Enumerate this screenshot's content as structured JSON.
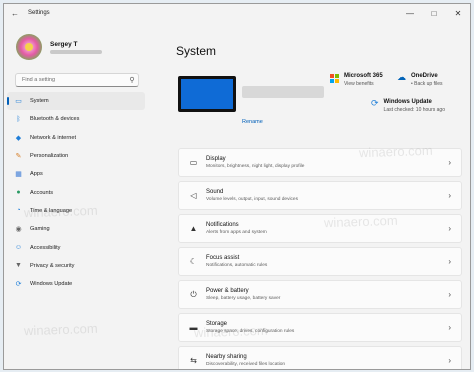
{
  "window": {
    "title": "Settings",
    "controls": [
      "minimize-icon",
      "maximize-icon",
      "close-icon"
    ]
  },
  "profile": {
    "name": "Sergey T"
  },
  "search": {
    "placeholder": "Find a setting"
  },
  "nav": {
    "items": [
      {
        "label": "System",
        "icon": "monitor-icon",
        "active": true,
        "color": "#1f7ed8"
      },
      {
        "label": "Bluetooth & devices",
        "icon": "bluetooth-icon",
        "color": "#1f7ed8"
      },
      {
        "label": "Network & internet",
        "icon": "wifi-icon",
        "color": "#1f7ed8"
      },
      {
        "label": "Personalization",
        "icon": "brush-icon",
        "color": "#d67f2a"
      },
      {
        "label": "Apps",
        "icon": "apps-icon",
        "color": "#3c7bd6"
      },
      {
        "label": "Accounts",
        "icon": "person-icon",
        "color": "#2a9a64"
      },
      {
        "label": "Time & language",
        "icon": "globe-clock-icon",
        "color": "#1f7ed8"
      },
      {
        "label": "Gaming",
        "icon": "gamepad-icon",
        "color": "#666666"
      },
      {
        "label": "Accessibility",
        "icon": "accessibility-icon",
        "color": "#1f7ed8"
      },
      {
        "label": "Privacy & security",
        "icon": "shield-icon",
        "color": "#666666"
      },
      {
        "label": "Windows Update",
        "icon": "update-icon",
        "color": "#1f7ed8"
      }
    ]
  },
  "main": {
    "title": "System",
    "rename": "Rename",
    "quick": [
      {
        "title": "Microsoft 365",
        "sub": "View benefits",
        "icon": "microsoft-logo-icon"
      },
      {
        "title": "OneDrive",
        "sub": "• Back up files",
        "icon": "onedrive-icon"
      },
      {
        "title": "Windows Update",
        "sub": "Last checked: 10 hours ago",
        "icon": "windows-update-icon"
      }
    ],
    "cards": [
      {
        "title": "Display",
        "sub": "Monitors, brightness, night light, display profile",
        "icon": "display-icon"
      },
      {
        "title": "Sound",
        "sub": "Volume levels, output, input, sound devices",
        "icon": "speaker-icon"
      },
      {
        "title": "Notifications",
        "sub": "Alerts from apps and system",
        "icon": "bell-icon"
      },
      {
        "title": "Focus assist",
        "sub": "Notifications, automatic rules",
        "icon": "moon-icon"
      },
      {
        "title": "Power & battery",
        "sub": "Sleep, battery usage, battery saver",
        "icon": "power-icon"
      },
      {
        "title": "Storage",
        "sub": "Storage space, drives, configuration rules",
        "icon": "storage-icon"
      },
      {
        "title": "Nearby sharing",
        "sub": "Discoverability, received files location",
        "icon": "share-icon"
      }
    ]
  },
  "watermark": "winaero.com"
}
